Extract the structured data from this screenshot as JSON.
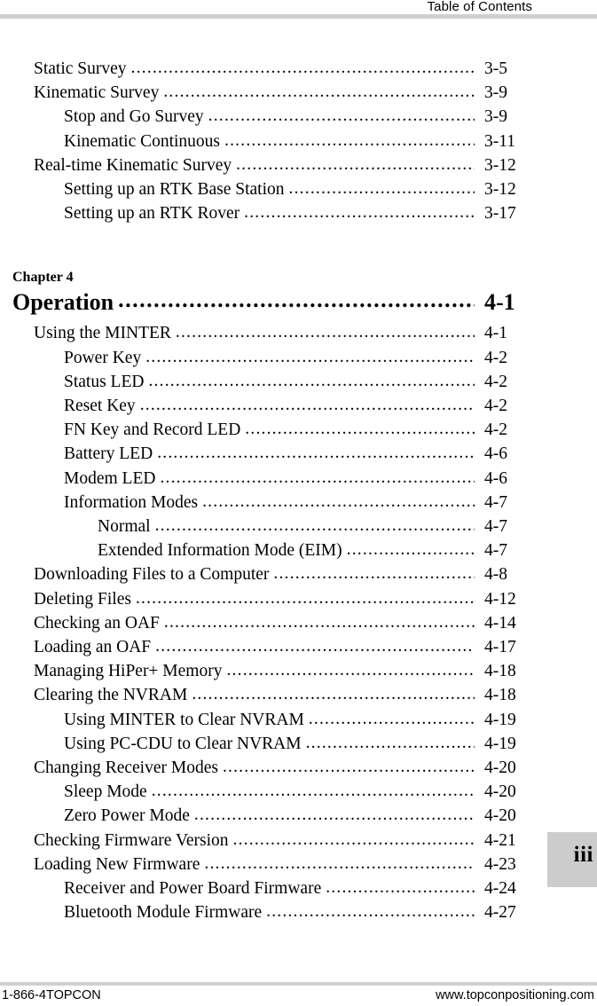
{
  "header": {
    "title": "Table of Contents"
  },
  "toc": {
    "section_one": [
      {
        "level": 1,
        "title": "Static Survey",
        "page": "3-5"
      },
      {
        "level": 1,
        "title": "Kinematic Survey",
        "page": "3-9"
      },
      {
        "level": 2,
        "title": "Stop and Go Survey",
        "page": "3-9"
      },
      {
        "level": 2,
        "title": "Kinematic Continuous",
        "page": "3-11"
      },
      {
        "level": 1,
        "title": "Real-time Kinematic Survey",
        "page": "3-12"
      },
      {
        "level": 2,
        "title": "Setting up an RTK Base Station",
        "page": "3-12"
      },
      {
        "level": 2,
        "title": "Setting up an RTK Rover",
        "page": "3-17"
      }
    ],
    "chapter": {
      "label": "Chapter 4",
      "title": "Operation",
      "page": "4-1"
    },
    "section_two": [
      {
        "level": 1,
        "title": "Using the MINTER",
        "page": "4-1"
      },
      {
        "level": 2,
        "title": "Power Key",
        "page": "4-2"
      },
      {
        "level": 2,
        "title": "Status LED",
        "page": "4-2"
      },
      {
        "level": 2,
        "title": "Reset Key",
        "page": "4-2"
      },
      {
        "level": 2,
        "title": "FN Key and Record LED",
        "page": "4-2"
      },
      {
        "level": 2,
        "title": "Battery LED",
        "page": "4-6"
      },
      {
        "level": 2,
        "title": "Modem LED",
        "page": "4-6"
      },
      {
        "level": 2,
        "title": "Information Modes",
        "page": "4-7"
      },
      {
        "level": 3,
        "title": "Normal",
        "page": "4-7"
      },
      {
        "level": 3,
        "title": "Extended Information Mode (EIM)",
        "page": "4-7"
      },
      {
        "level": 1,
        "title": "Downloading Files to a Computer",
        "page": "4-8"
      },
      {
        "level": 1,
        "title": "Deleting Files",
        "page": "4-12"
      },
      {
        "level": 1,
        "title": "Checking an OAF",
        "page": "4-14"
      },
      {
        "level": 1,
        "title": "Loading an OAF",
        "page": "4-17"
      },
      {
        "level": 1,
        "title": "Managing HiPer+ Memory",
        "page": "4-18"
      },
      {
        "level": 1,
        "title": "Clearing the NVRAM",
        "page": "4-18"
      },
      {
        "level": 2,
        "title": "Using MINTER to Clear NVRAM",
        "page": "4-19"
      },
      {
        "level": 2,
        "title": "Using PC-CDU to Clear NVRAM",
        "page": "4-19"
      },
      {
        "level": 1,
        "title": "Changing Receiver Modes",
        "page": "4-20"
      },
      {
        "level": 2,
        "title": "Sleep Mode",
        "page": "4-20"
      },
      {
        "level": 2,
        "title": "Zero Power Mode",
        "page": "4-20"
      },
      {
        "level": 1,
        "title": "Checking Firmware Version",
        "page": "4-21"
      },
      {
        "level": 1,
        "title": "Loading New Firmware",
        "page": "4-23"
      },
      {
        "level": 2,
        "title": "Receiver and Power Board Firmware",
        "page": "4-24"
      },
      {
        "level": 2,
        "title": "Bluetooth Module Firmware",
        "page": "4-27"
      }
    ]
  },
  "page_tab": {
    "number": "iii"
  },
  "footer": {
    "left": "1-866-4TOPCON",
    "right": "www.topconpositioning.com"
  },
  "colors": {
    "rule": "#d0d0d0",
    "tab_background": "#cccccc",
    "text": "#000000"
  }
}
